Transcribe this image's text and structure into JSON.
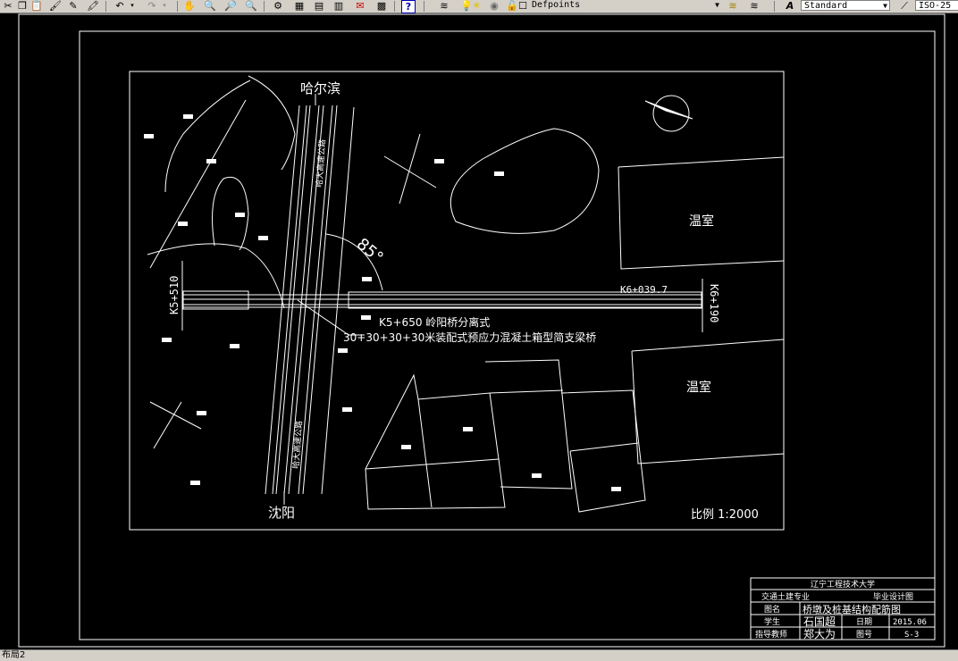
{
  "toolbar": {
    "layer_combo": "Defpoints",
    "text_style_combo": "Standard",
    "dim_style_combo": "ISO-25"
  },
  "drawing": {
    "north_city": "哈尔滨",
    "south_city": "沈阳",
    "station_start": "K5+510",
    "station_end": "K6+190",
    "station_mid": "K6+039.7",
    "bridge_name": "K5+650   岭阳桥分离式",
    "bridge_desc": "30+30+30+30米装配式预应力混凝土箱型简支梁桥",
    "angle": "85°",
    "greenhouse_1": "温室",
    "greenhouse_2": "温室",
    "scale": "比例 1:2000",
    "road_label_upper": "哈大高速公路",
    "road_label_lower": "哈大高速公路"
  },
  "title_block": {
    "school": "辽宁工程技术大学",
    "major": "交通土建专业",
    "design_type": "毕业设计图",
    "drawing_label": "图名",
    "drawing_name": "桥墩及桩基结构配筋图",
    "student_label": "学生",
    "student_name": "石国超",
    "date_label": "日期",
    "date": "2015.06",
    "teacher_label": "指导教师",
    "teacher_name": "郑大为",
    "number_label": "图号",
    "number": "S-3"
  },
  "statusbar": {
    "layout_tab": "布局2"
  }
}
